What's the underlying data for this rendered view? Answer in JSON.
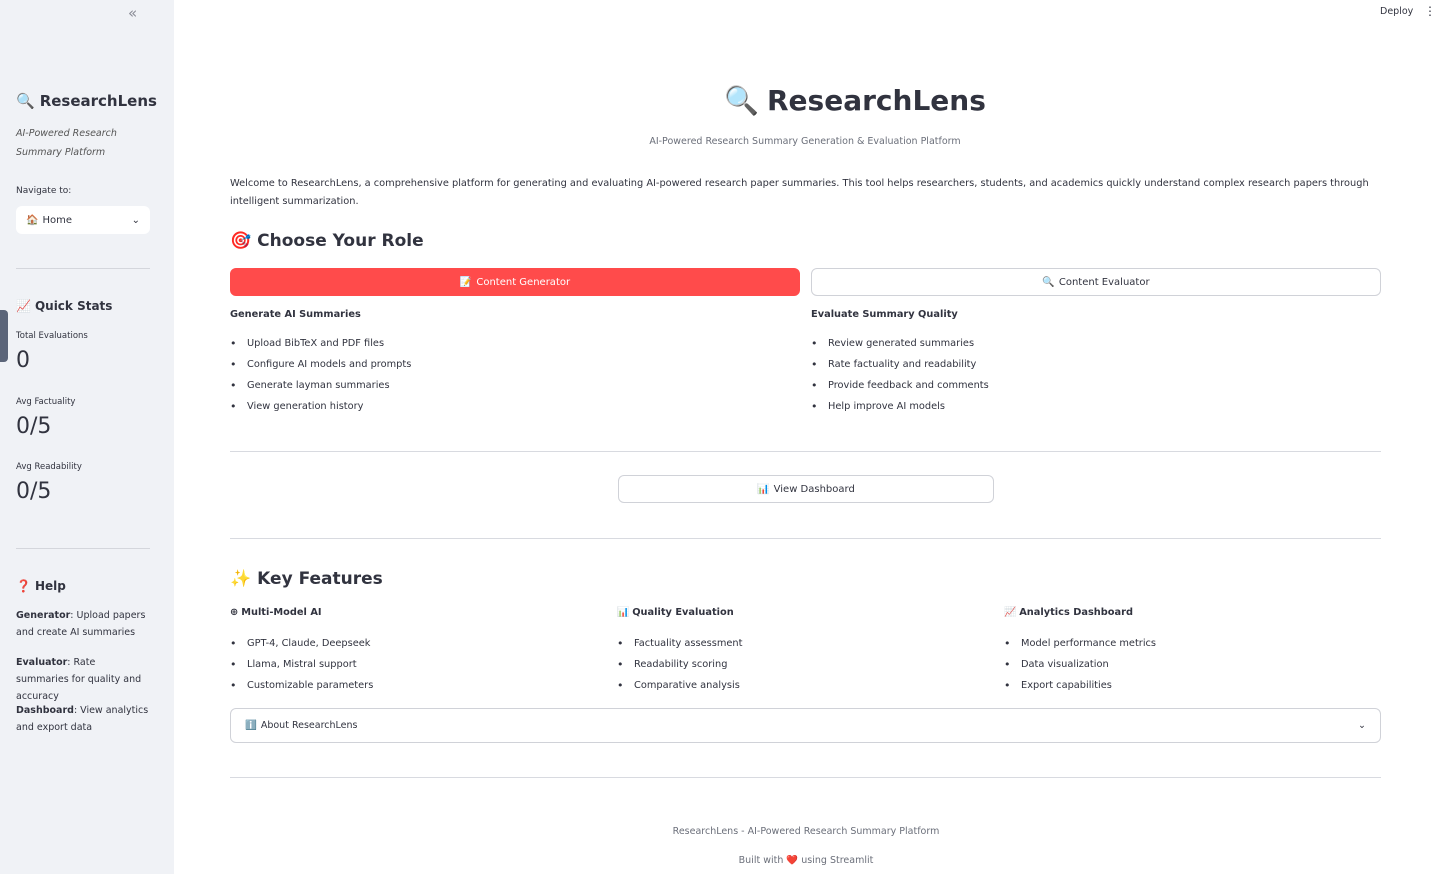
{
  "sidebar": {
    "collapse_icon": "«",
    "title_icon": "🔍",
    "title": "ResearchLens",
    "subtitle": "AI-Powered Research Summary Platform",
    "nav_label": "Navigate to:",
    "nav_select_icon": "🏠",
    "nav_selected": "Home",
    "nav_chevron": "⌄",
    "stats_icon": "📈",
    "stats_heading": "Quick Stats",
    "stats": [
      {
        "label": "Total Evaluations",
        "value": "0"
      },
      {
        "label": "Avg Factuality",
        "value": "0/5"
      },
      {
        "label": "Avg Readability",
        "value": "0/5"
      }
    ],
    "help_icon": "❓",
    "help_heading": "Help",
    "help": [
      {
        "term": "Generator",
        "text": ": Upload papers and create AI summaries"
      },
      {
        "term": "Evaluator",
        "text": ": Rate summaries for quality and accuracy"
      },
      {
        "term": "Dashboard",
        "text": ": View analytics and export data"
      }
    ]
  },
  "topbar": {
    "deploy_label": "Deploy",
    "menu_icon": "⋮"
  },
  "main": {
    "title_icon": "🔍",
    "title": "ResearchLens",
    "subtitle": "AI-Powered Research Summary Generation & Evaluation Platform",
    "welcome": "Welcome to ResearchLens, a comprehensive platform for generating and evaluating AI-powered research paper summaries. This tool helps researchers, students, and academics quickly understand complex research papers through intelligent summarization.",
    "role_icon": "🎯",
    "role_heading": "Choose Your Role",
    "generator_button": {
      "icon": "📝",
      "label": "Content Generator"
    },
    "evaluator_button": {
      "icon": "🔍",
      "label": "Content Evaluator"
    },
    "generator_col": {
      "heading": "Generate AI Summaries",
      "items": [
        "Upload BibTeX and PDF files",
        "Configure AI models and prompts",
        "Generate layman summaries",
        "View generation history"
      ]
    },
    "evaluator_col": {
      "heading": "Evaluate Summary Quality",
      "items": [
        "Review generated summaries",
        "Rate factuality and readability",
        "Provide feedback and comments",
        "Help improve AI models"
      ]
    },
    "dashboard_button": {
      "icon": "📊",
      "label": "View Dashboard"
    },
    "features_icon": "✨",
    "features_heading": "Key Features",
    "features": [
      {
        "icon": "⊕",
        "heading": "Multi-Model AI",
        "items": [
          "GPT-4, Claude, Deepseek",
          "Llama, Mistral support",
          "Customizable parameters"
        ]
      },
      {
        "icon": "📊",
        "heading": "Quality Evaluation",
        "items": [
          "Factuality assessment",
          "Readability scoring",
          "Comparative analysis"
        ]
      },
      {
        "icon": "📈",
        "heading": "Analytics Dashboard",
        "items": [
          "Model performance metrics",
          "Data visualization",
          "Export capabilities"
        ]
      }
    ],
    "expander": {
      "icon": "ℹ️",
      "label": "About ResearchLens",
      "chevron": "⌄"
    },
    "footer_line1": "ResearchLens - AI-Powered Research Summary Platform",
    "footer_built": "Built with",
    "footer_heart": "❤️",
    "footer_using": "using Streamlit"
  }
}
